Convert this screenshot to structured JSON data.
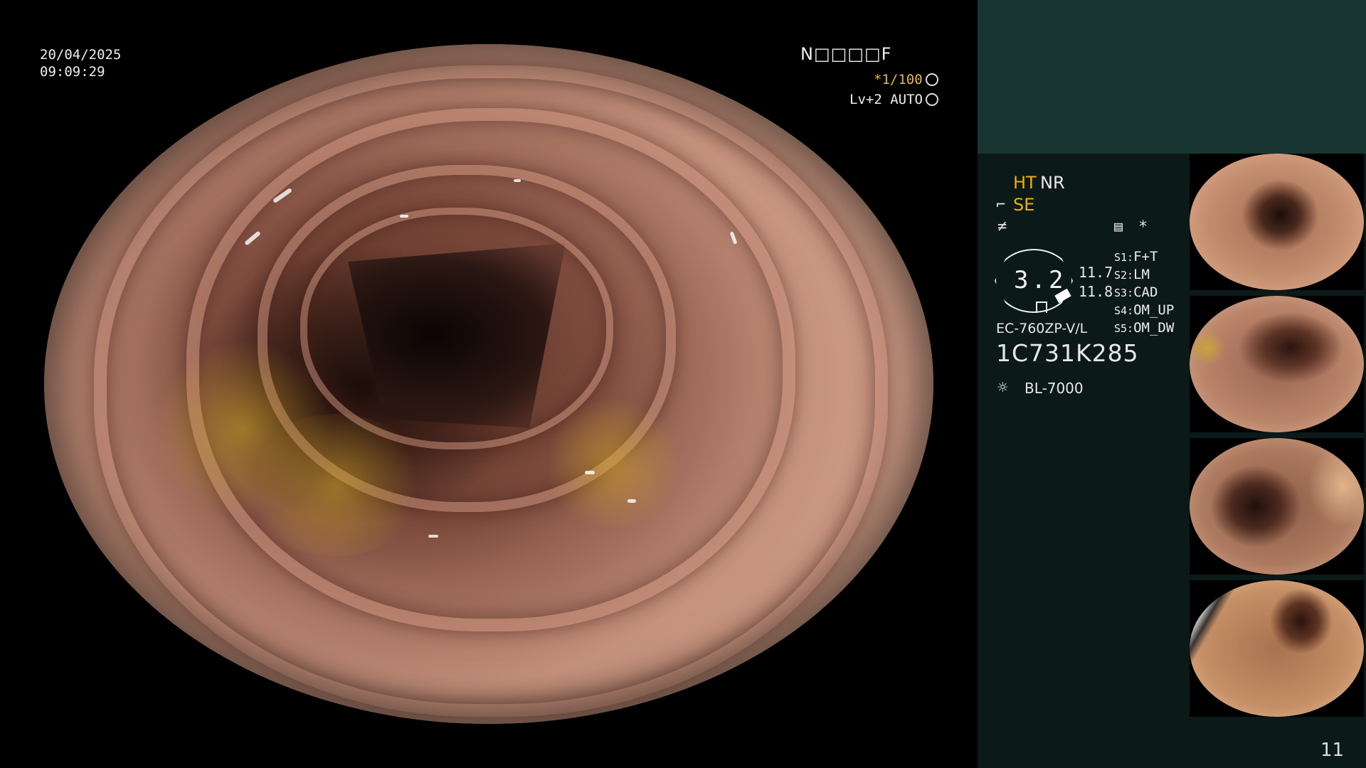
{
  "osd": {
    "date": "20/04/2025",
    "time": "09:09:29",
    "patient_id": "N□□□□F",
    "shutter": "*1/100",
    "level": "Lv+2 AUTO"
  },
  "panel": {
    "ht": "HT",
    "nr": "NR",
    "se": "SE",
    "gauge_value": "3.2",
    "value1": "11.7",
    "value2": "11.8",
    "settings": [
      {
        "key": "S1:",
        "value": "F+T"
      },
      {
        "key": "S2:",
        "value": "LM"
      },
      {
        "key": "S3:",
        "value": "CAD"
      },
      {
        "key": "S4:",
        "value": "OM_UP"
      },
      {
        "key": "S5:",
        "value": "OM_DW"
      }
    ],
    "scope_model": "EC-760ZP-V/L",
    "serial": "1C731K285",
    "light_source": "BL-7000",
    "page_number": "11"
  },
  "icons": [
    "shutter-icon",
    "auto-icon",
    "structure-icon",
    "color-icon",
    "memory-icon",
    "asterisk-icon",
    "light-source-icon"
  ],
  "thumbnails": [
    {
      "name": "thumbnail-1"
    },
    {
      "name": "thumbnail-2"
    },
    {
      "name": "thumbnail-3"
    },
    {
      "name": "thumbnail-4"
    }
  ]
}
